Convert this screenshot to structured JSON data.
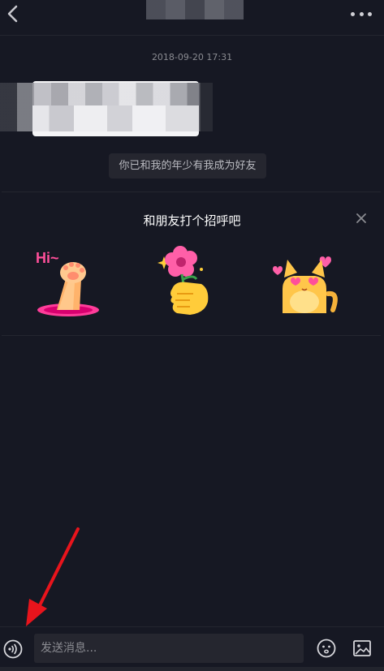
{
  "header": {
    "back_icon": "chevron-left-icon",
    "more_icon": "more-dots-icon"
  },
  "chat": {
    "timestamp": "2018-09-20 17:31",
    "system_note": "你已和我的年少有我成为好友"
  },
  "greeting": {
    "title": "和朋友打个招呼吧",
    "close_icon": "close-icon",
    "stickers": [
      {
        "name": "hi-paw-sticker",
        "text": "Hi~"
      },
      {
        "name": "flower-hand-sticker"
      },
      {
        "name": "love-cat-sticker"
      }
    ]
  },
  "composer": {
    "placeholder": "发送消息...",
    "voice_icon": "voice-icon",
    "emoji_icon": "emoji-icon",
    "image_icon": "image-icon"
  },
  "colors": {
    "background": "#161823",
    "input_bg": "#25262f",
    "annotation_arrow": "#e8141c",
    "sticker_pink": "#ff4f9a"
  }
}
